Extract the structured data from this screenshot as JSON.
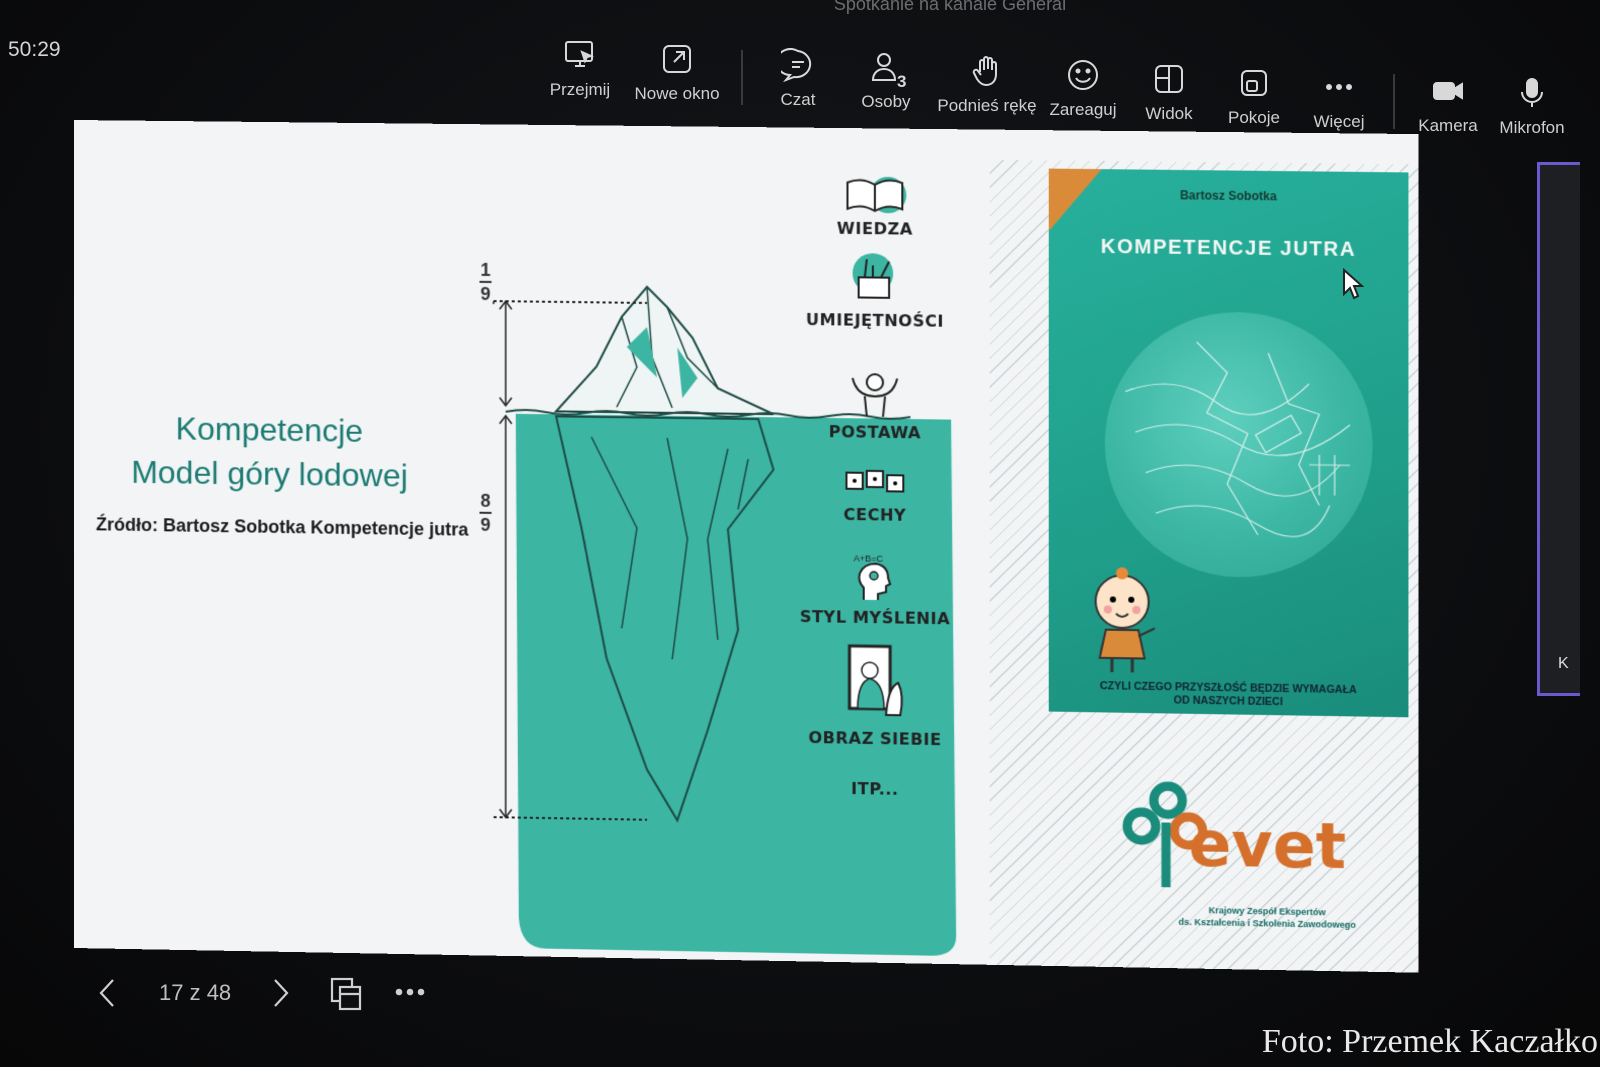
{
  "meeting_title": "Spotkanie na kanale General",
  "timer": "50:29",
  "toolbar": {
    "take_control": "Przejmij",
    "new_window": "Nowe okno",
    "chat": "Czat",
    "people": "Osoby",
    "people_count": "3",
    "raise_hand": "Podnieś rękę",
    "react": "Zareaguj",
    "view": "Widok",
    "rooms": "Pokoje",
    "more": "Więcej",
    "camera": "Kamera",
    "mic": "Mikrofon"
  },
  "slide": {
    "title_line1": "Kompetencje",
    "title_line2": "Model góry lodowej",
    "source": "Źródło: Bartosz Sobotka Kompetencje jutra",
    "fraction_top": {
      "num": "1",
      "den": "9"
    },
    "fraction_bottom": {
      "num": "8",
      "den": "9"
    },
    "labels": {
      "wiedza": "WIEDZA",
      "umiejetnosci": "UMIEJĘTNOŚCI",
      "postawa": "POSTAWA",
      "cechy": "CECHY",
      "styl_myslenia": "STYL MYŚLENIA",
      "obraz_siebie": "OBRAZ SIEBIE",
      "itp": "ITP..."
    },
    "book": {
      "author": "Bartosz Sobotka",
      "title": "KOMPETENCJE JUTRA",
      "subtitle_line1": "CZYLI CZEGO PRZYSZŁOŚĆ BĘDZIE WYMAGAŁA",
      "subtitle_line2": "OD NASZYCH DZIECI"
    },
    "logo": {
      "word": "evet",
      "caption_line1": "Krajowy Zespół Ekspertów",
      "caption_line2": "ds. Kształcenia i Szkolenia Zawodowego"
    }
  },
  "nav": {
    "page_count": "17 z 48"
  },
  "right_tile_letter": "K",
  "photo_credit": "Foto: Przemek Kaczałko",
  "colors": {
    "teal": "#3cb5a3",
    "title_teal": "#1b7b73",
    "logo_orange": "#d5702c"
  }
}
